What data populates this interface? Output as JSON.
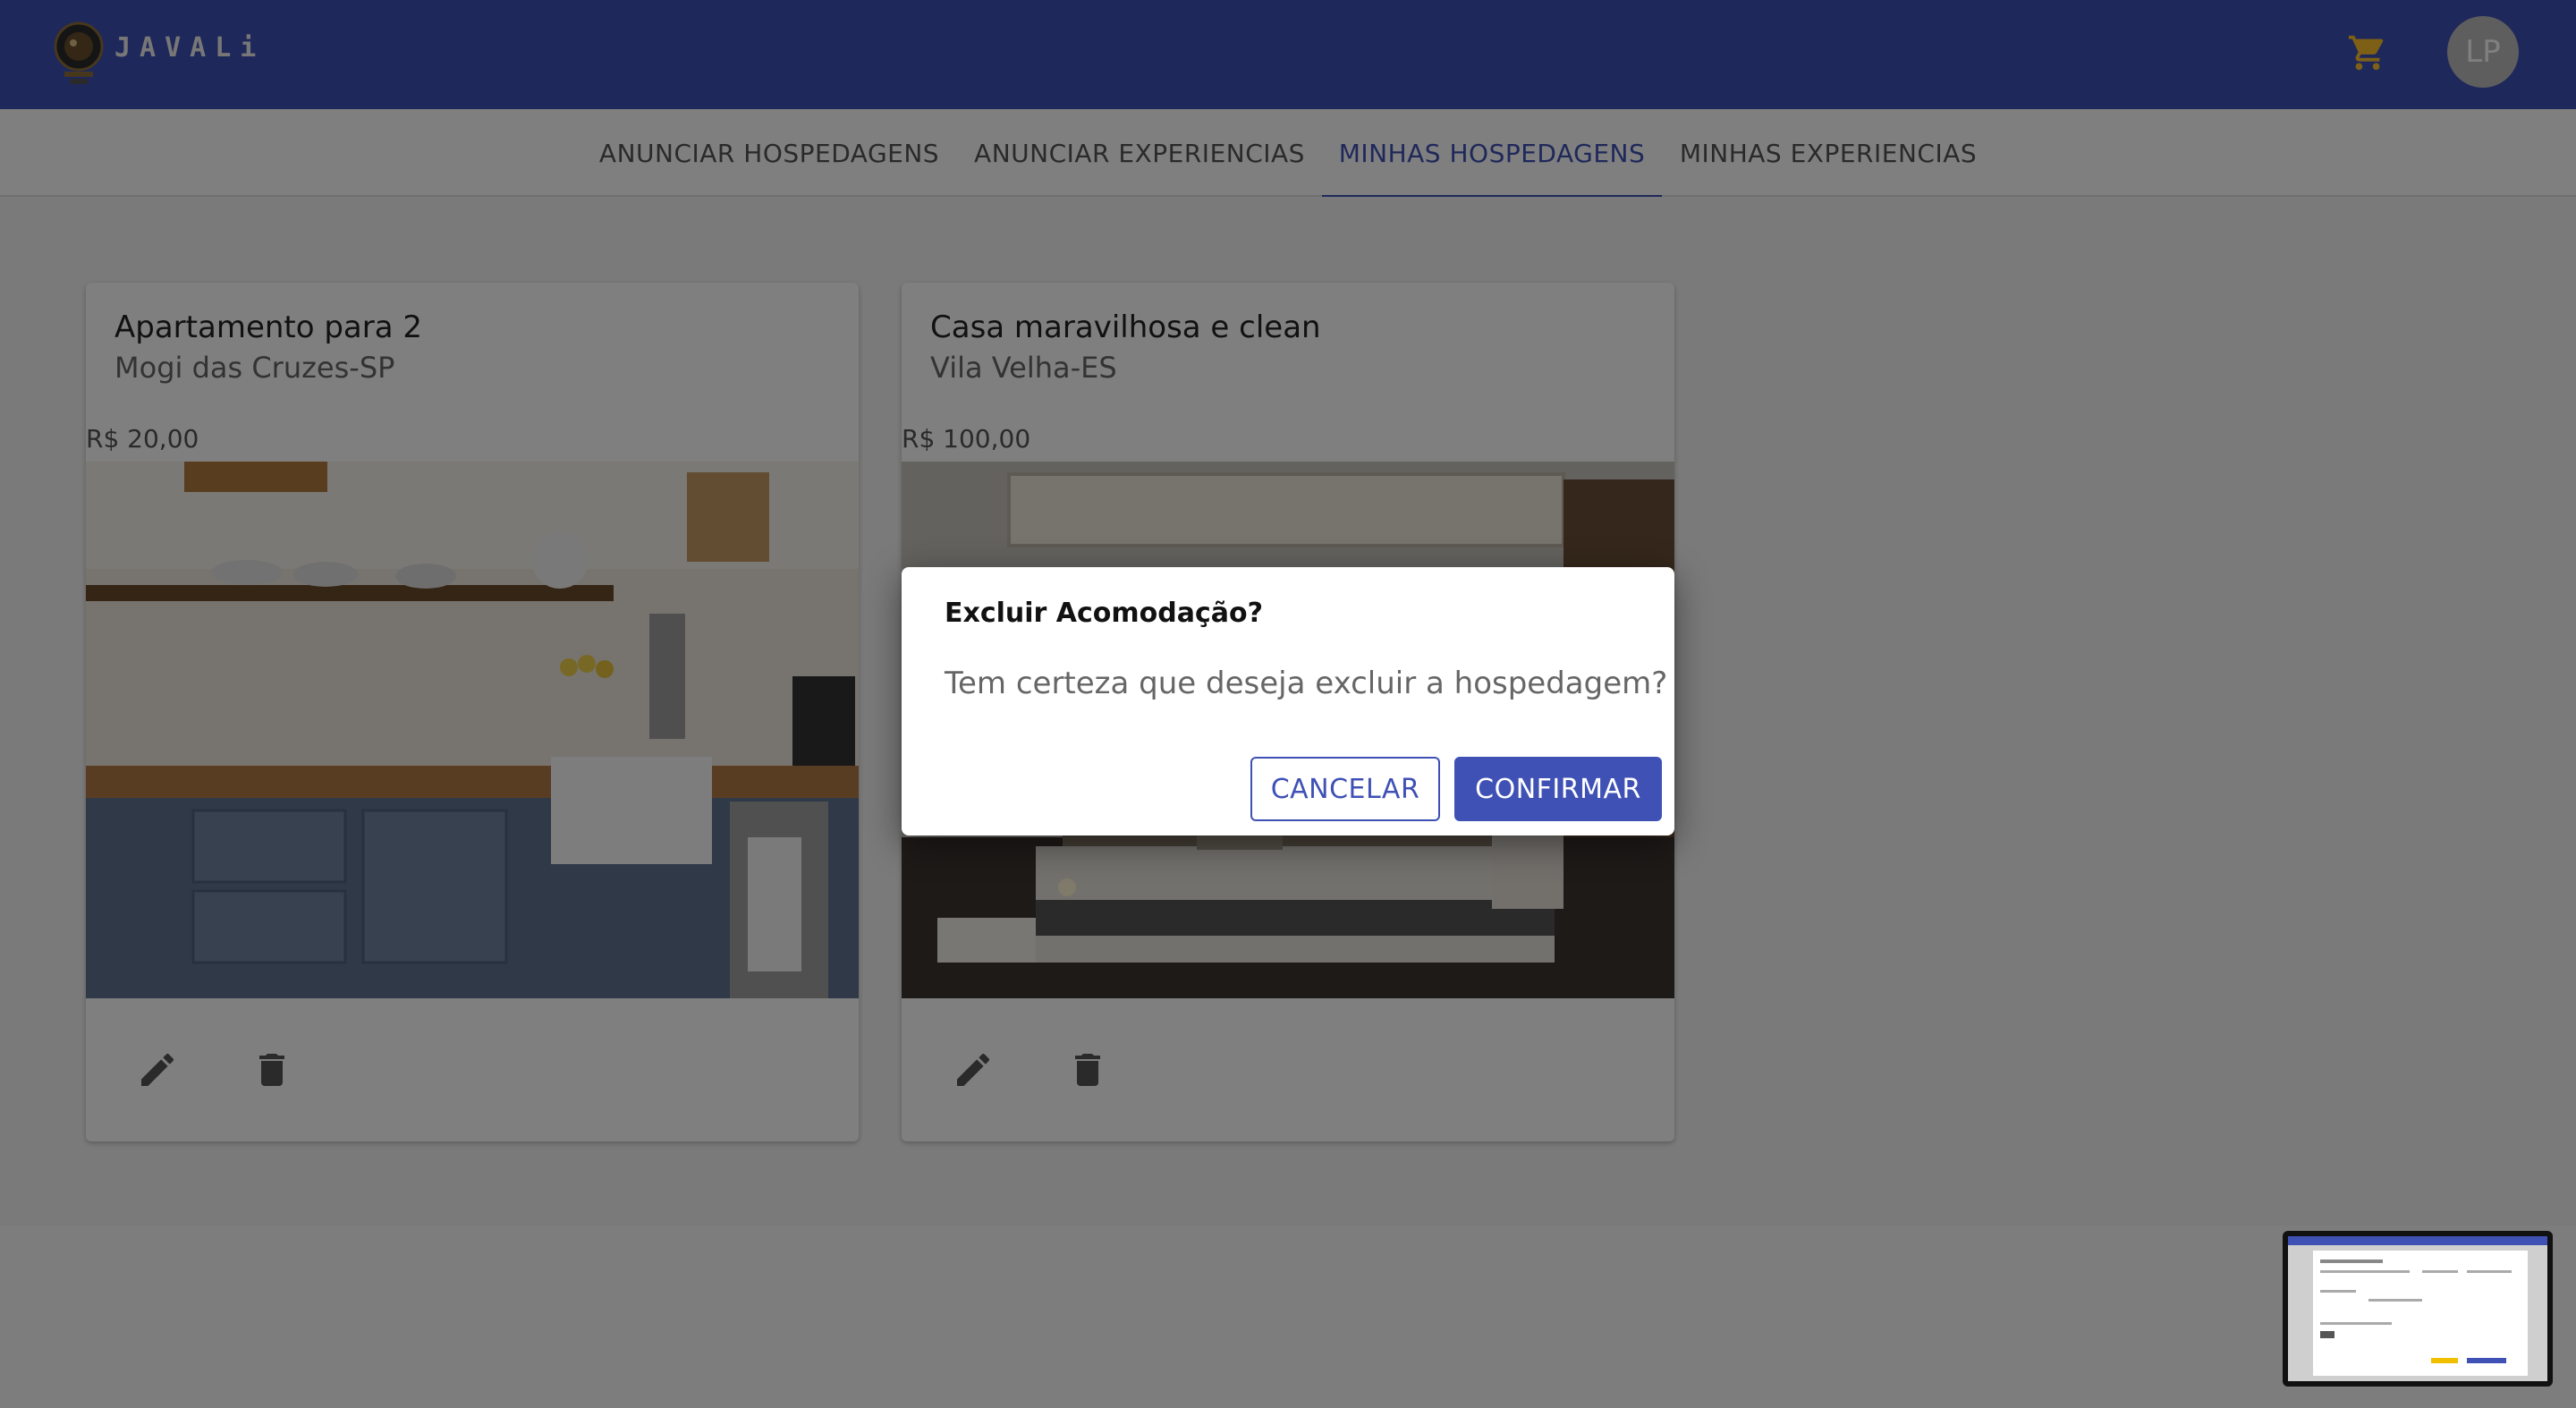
{
  "header": {
    "logo_text": "JAVALi",
    "avatar_initials": "LP",
    "cart_icon": "cart-icon",
    "brand_color": "#3f51b5"
  },
  "tabs": [
    {
      "label": "ANUNCIAR HOSPEDAGENS",
      "active": false
    },
    {
      "label": "ANUNCIAR EXPERIENCIAS",
      "active": false
    },
    {
      "label": "MINHAS HOSPEDAGENS",
      "active": true
    },
    {
      "label": "MINHAS EXPERIENCIAS",
      "active": false
    }
  ],
  "listings": [
    {
      "title": "Apartamento para 2",
      "location": "Mogi das Cruzes-SP",
      "price": "R$ 20,00",
      "image": "kitchen-photo",
      "edit_icon": "pencil-icon",
      "delete_icon": "trash-icon"
    },
    {
      "title": "Casa maravilhosa e clean",
      "location": "Vila Velha-ES",
      "price": "R$ 100,00",
      "image": "bedroom-photo",
      "edit_icon": "pencil-icon",
      "delete_icon": "trash-icon"
    }
  ],
  "dialog": {
    "title": "Excluir Acomodação?",
    "message": "Tem certeza que deseja excluir a hospedagem?",
    "cancel_label": "CANCELAR",
    "confirm_label": "CONFIRMAR"
  }
}
